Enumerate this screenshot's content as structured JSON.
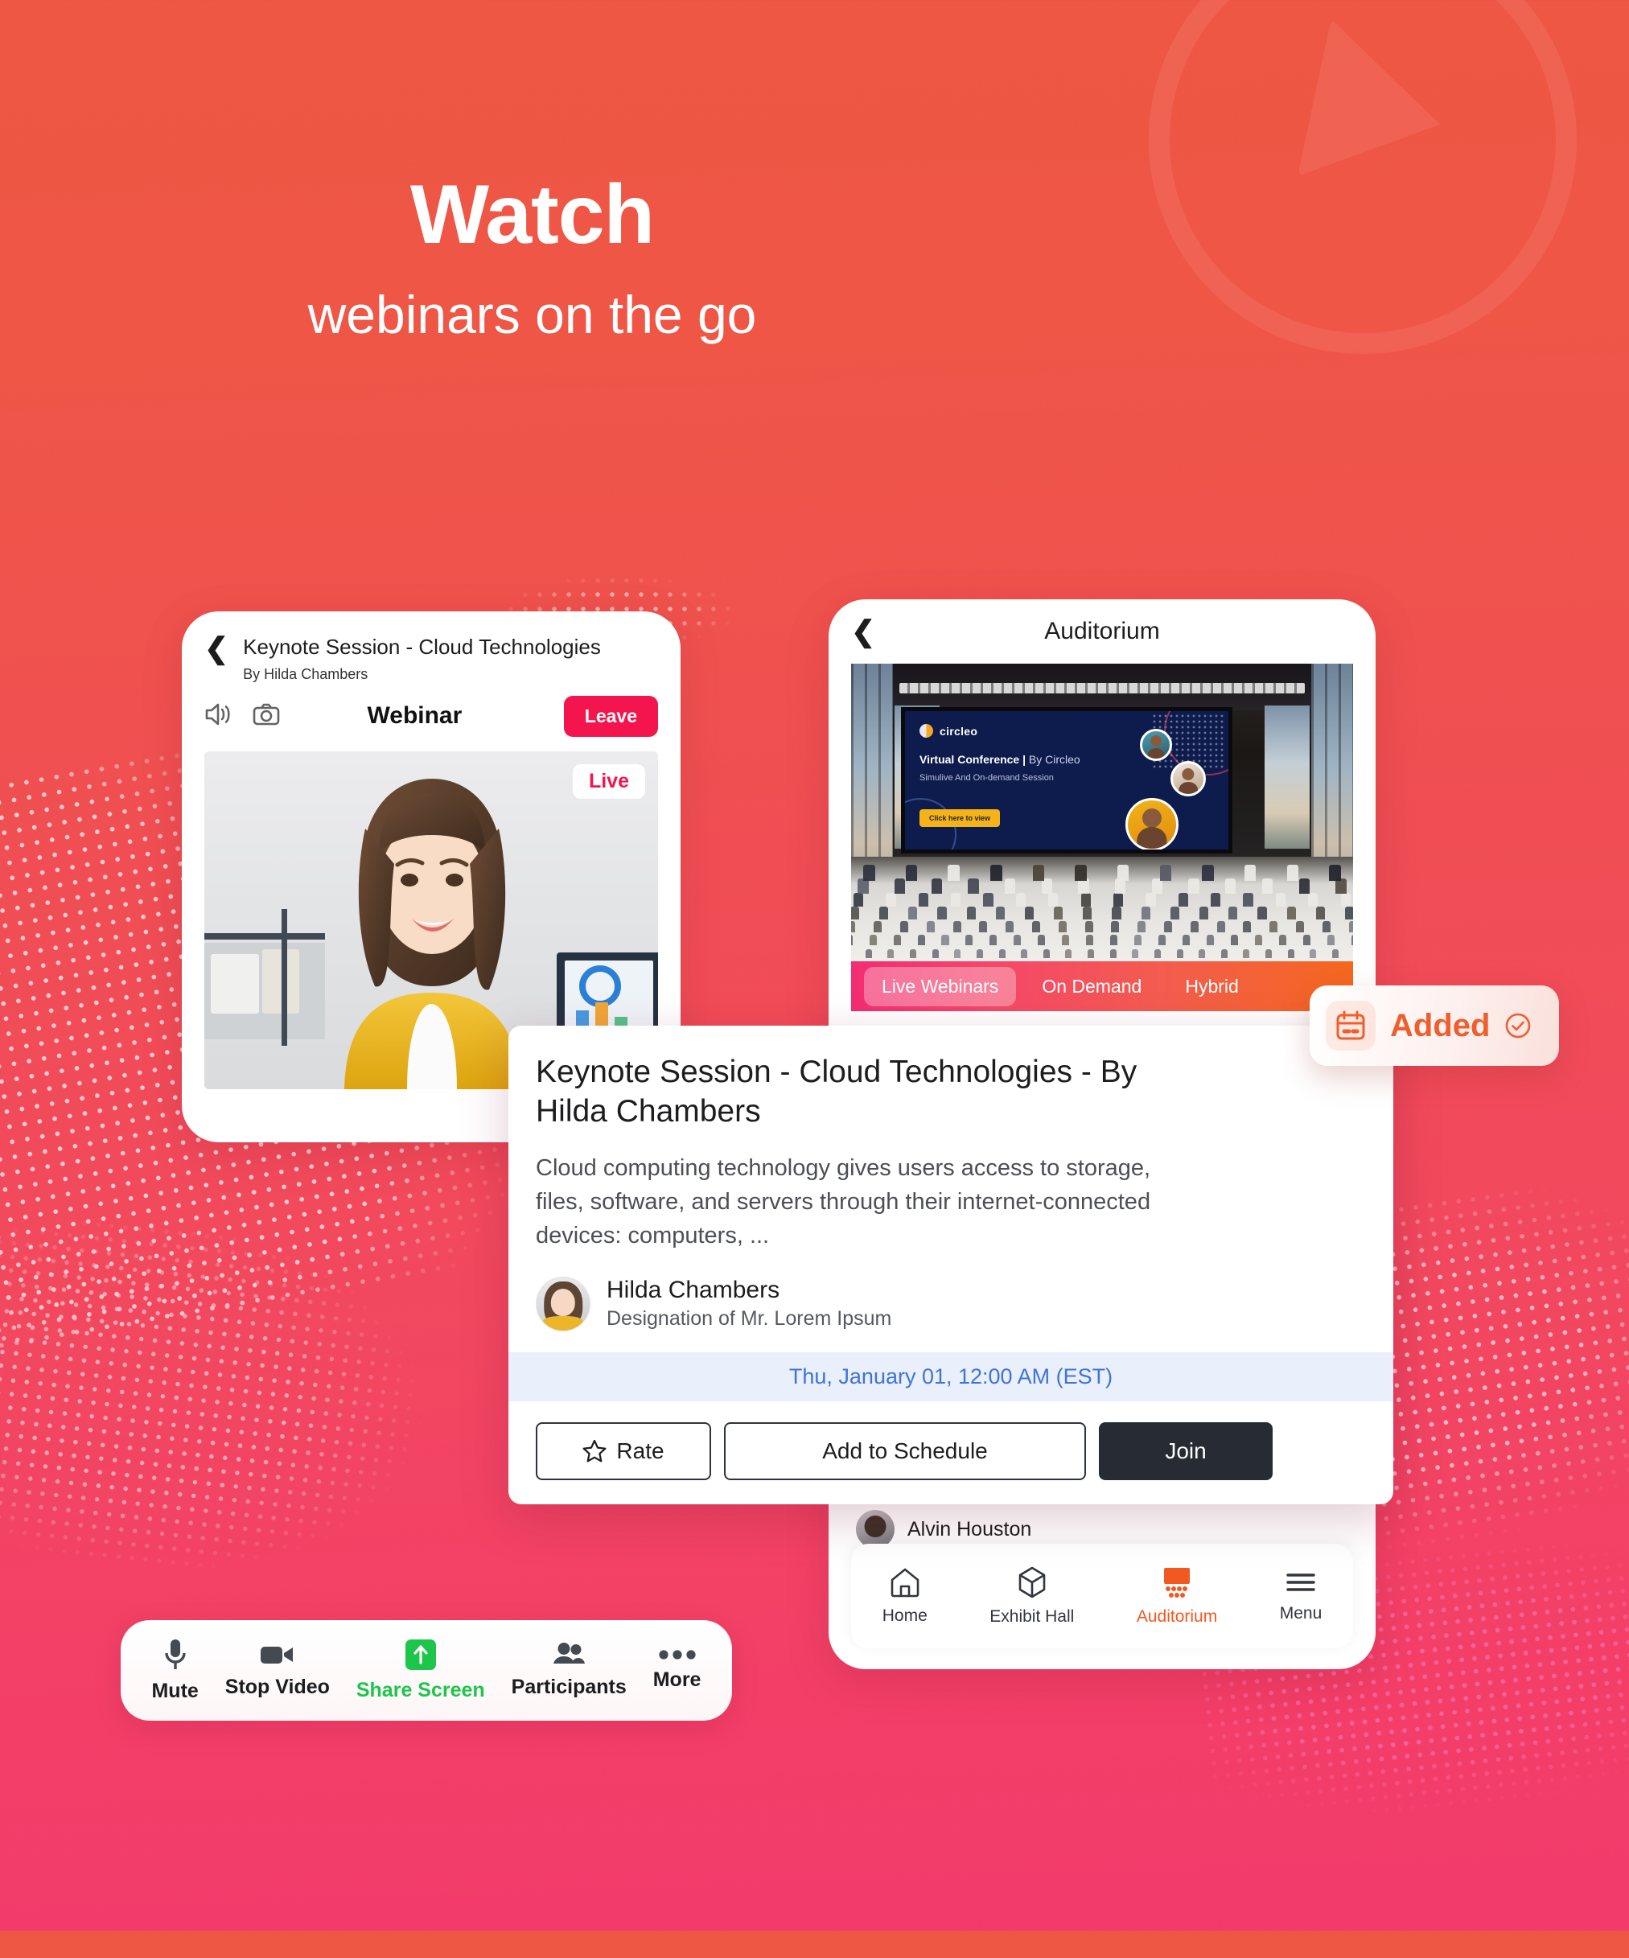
{
  "colors": {
    "bg_top": "#EE5743",
    "bg_bottom": "#F33F68",
    "accent_pink": "#F5154E",
    "accent_orange": "#F05E2E",
    "share_green": "#1DC54B",
    "join_dark": "#262B34",
    "date_blue": "#3F74D6"
  },
  "hero": {
    "title": "Watch",
    "subtitle": "webinars on the go",
    "play_icon": "play-circle-icon"
  },
  "webinar_phone": {
    "back_icon": "chevron-left-icon",
    "title": "Keynote Session - Cloud Technologies",
    "subtitle": "By Hilda Chambers",
    "speaker_icon": "volume-speaker-icon",
    "camera_icon": "camera-icon",
    "mode_label": "Webinar",
    "leave_label": "Leave",
    "live_label": "Live",
    "video_alt": "presenter-video-feed"
  },
  "meeting_toolbar": {
    "items": [
      {
        "label": "Mute",
        "icon": "microphone-icon",
        "active": false
      },
      {
        "label": "Stop Video",
        "icon": "video-camera-icon",
        "active": false
      },
      {
        "label": "Share Screen",
        "icon": "share-screen-arrow-icon",
        "active": true
      },
      {
        "label": "Participants",
        "icon": "participants-icon",
        "active": false
      },
      {
        "label": "More",
        "icon": "ellipsis-icon",
        "active": false
      }
    ]
  },
  "auditorium_phone": {
    "back_icon": "chevron-left-icon",
    "title": "Auditorium",
    "stage": {
      "brand": "circleo",
      "headline_bold": "Virtual Conference |",
      "headline_light": " By Circleo",
      "subline": "Simulive And On-demand Session",
      "cta": "Click here to view"
    },
    "tabs": [
      {
        "label": "Live Webinars",
        "active": true
      },
      {
        "label": "On Demand",
        "active": false
      },
      {
        "label": "Hybrid",
        "active": false
      }
    ],
    "behind_list": {
      "heading": "Alvin Houston",
      "row_name": "Alvin Houston"
    },
    "bottom_nav": [
      {
        "label": "Home",
        "icon": "home-icon",
        "active": false
      },
      {
        "label": "Exhibit Hall",
        "icon": "cube-icon",
        "active": false
      },
      {
        "label": "Auditorium",
        "icon": "auditorium-icon",
        "active": true
      },
      {
        "label": "Menu",
        "icon": "hamburger-menu-icon",
        "active": false
      }
    ]
  },
  "detail_card": {
    "title": "Keynote Session - Cloud Technologies - By Hilda Chambers",
    "description": "Cloud computing technology gives users access to storage, files, software, and servers through their internet-connected devices: computers, ...",
    "speaker_name": "Hilda Chambers",
    "speaker_designation": "Designation of Mr. Lorem Ipsum",
    "datetime": "Thu, January 01, 12:00 AM (EST)",
    "actions": {
      "rate": "Rate",
      "rate_icon": "star-outline-icon",
      "schedule": "Add to Schedule",
      "join": "Join"
    }
  },
  "added_badge": {
    "label": "Added",
    "calendar_icon": "calendar-icon",
    "check_icon": "check-circle-icon"
  }
}
